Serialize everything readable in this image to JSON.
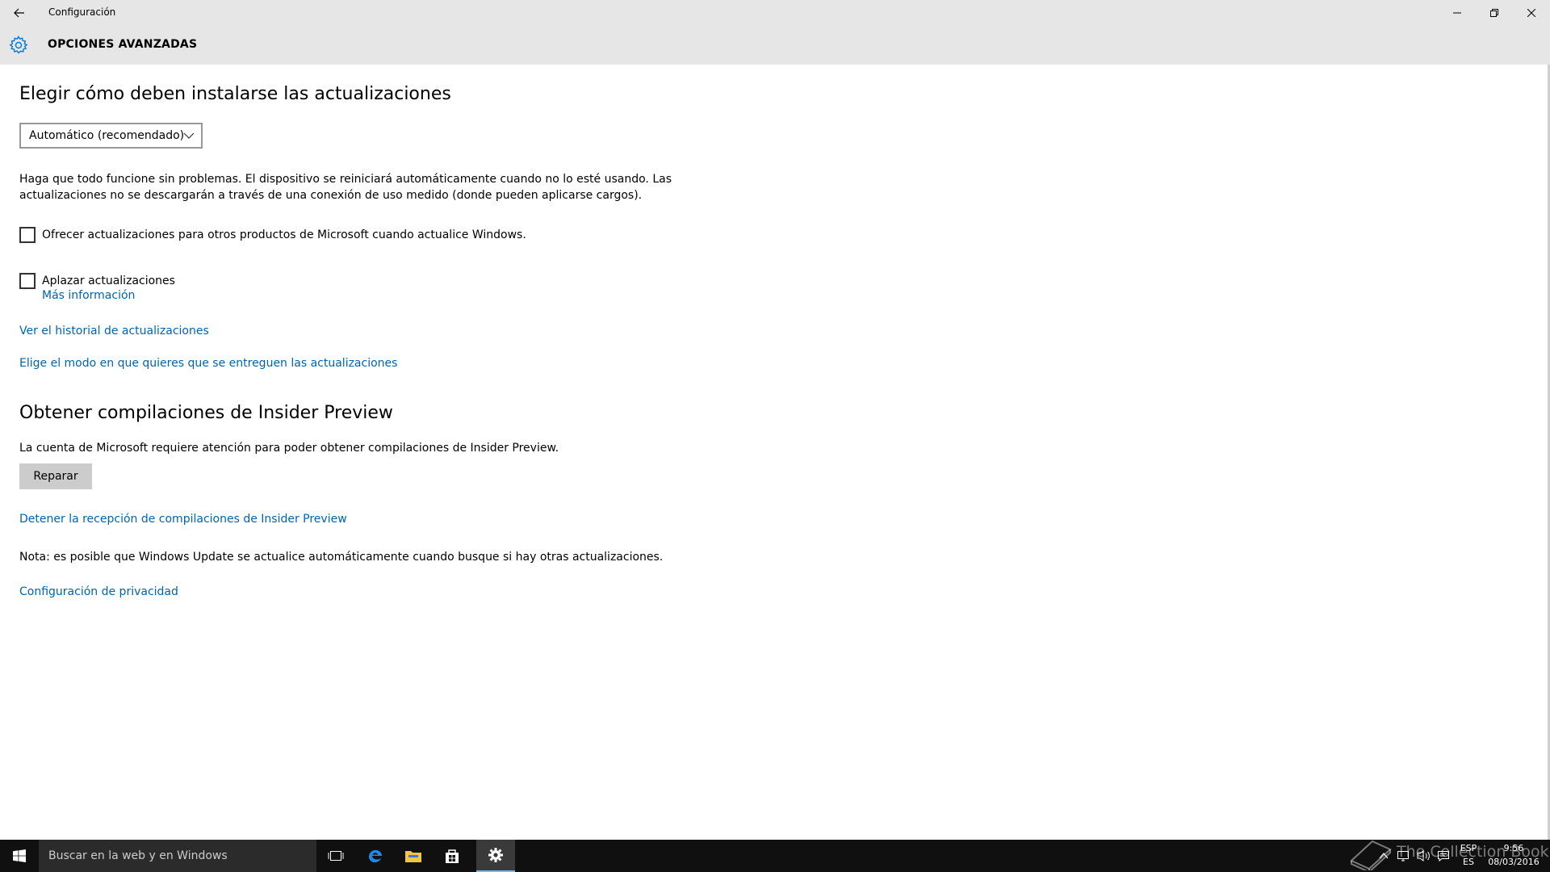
{
  "window": {
    "app_title": "Configuración",
    "page_title": "OPCIONES AVANZADAS"
  },
  "install_section": {
    "heading": "Elegir cómo deben instalarse las actualizaciones",
    "dropdown_value": "Automático (recomendado)",
    "description_line1": "Haga que todo funcione sin problemas. El dispositivo se reiniciará automáticamente cuando no lo esté usando. Las",
    "description_line2": "actualizaciones no se descargarán a través de una conexión de uso medido (donde pueden aplicarse cargos).",
    "checkbox_offer_label": "Ofrecer actualizaciones para otros productos de Microsoft cuando actualice Windows.",
    "checkbox_offer_checked": false,
    "checkbox_defer_label": "Aplazar actualizaciones",
    "checkbox_defer_checked": false,
    "more_info_link": "Más información",
    "history_link": "Ver el historial de actualizaciones",
    "delivery_link": "Elige el modo en que quieres que se entreguen las actualizaciones"
  },
  "insider_section": {
    "heading": "Obtener compilaciones de Insider Preview",
    "description": "La cuenta de Microsoft requiere atención para poder obtener compilaciones de Insider Preview.",
    "repair_button": "Reparar",
    "stop_link": "Detener la recepción de compilaciones de Insider Preview",
    "note": "Nota: es posible que Windows Update se actualice automáticamente cuando busque si hay otras actualizaciones.",
    "privacy_link": "Configuración de privacidad"
  },
  "taskbar": {
    "search_placeholder": "Buscar en la web y en Windows",
    "language_top": "ESP",
    "language_bottom": "ES",
    "time": "9:56",
    "date": "08/03/2016",
    "watermark": "The Collection Book"
  },
  "colors": {
    "link": "#0063b1",
    "chrome_bg": "#e6e6e6",
    "taskbar_bg": "#101010",
    "accent": "#0078d7"
  },
  "icons": [
    "back-arrow-icon",
    "minimize-icon",
    "maximize-icon",
    "close-icon",
    "gear-icon",
    "chevron-down-icon",
    "windows-logo-icon",
    "task-view-icon",
    "edge-icon",
    "file-explorer-icon",
    "store-icon",
    "settings-icon",
    "chevron-up-icon",
    "network-icon",
    "volume-icon",
    "action-center-icon"
  ]
}
